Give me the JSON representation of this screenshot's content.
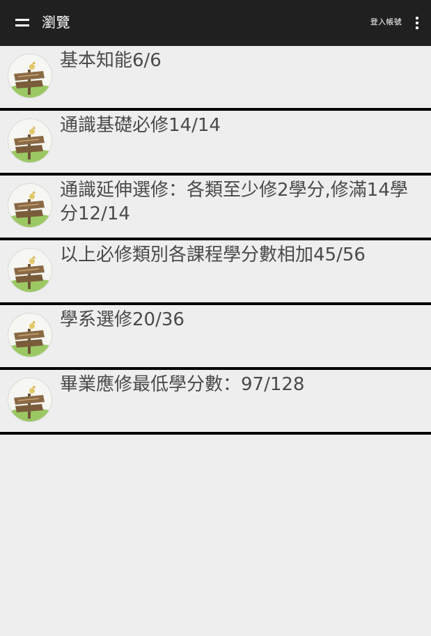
{
  "appbar": {
    "menu_icon": "hamburger-menu-icon",
    "title": "瀏覽",
    "login_label": "登入帳號",
    "overflow_icon": "more-vert-icon"
  },
  "list": {
    "items": [
      {
        "label": "基本知能6/6",
        "icon": "signpost-thumbnail"
      },
      {
        "label": "通識基礎必修14/14",
        "icon": "signpost-thumbnail"
      },
      {
        "label": "通識延伸選修：各類至少修2學分,修滿14學分12/14",
        "icon": "signpost-thumbnail"
      },
      {
        "label": "以上必修類別各課程學分數相加45/56",
        "icon": "signpost-thumbnail"
      },
      {
        "label": "學系選修20/36",
        "icon": "signpost-thumbnail"
      },
      {
        "label": "畢業應修最低學分數：97/128",
        "icon": "signpost-thumbnail"
      }
    ]
  }
}
